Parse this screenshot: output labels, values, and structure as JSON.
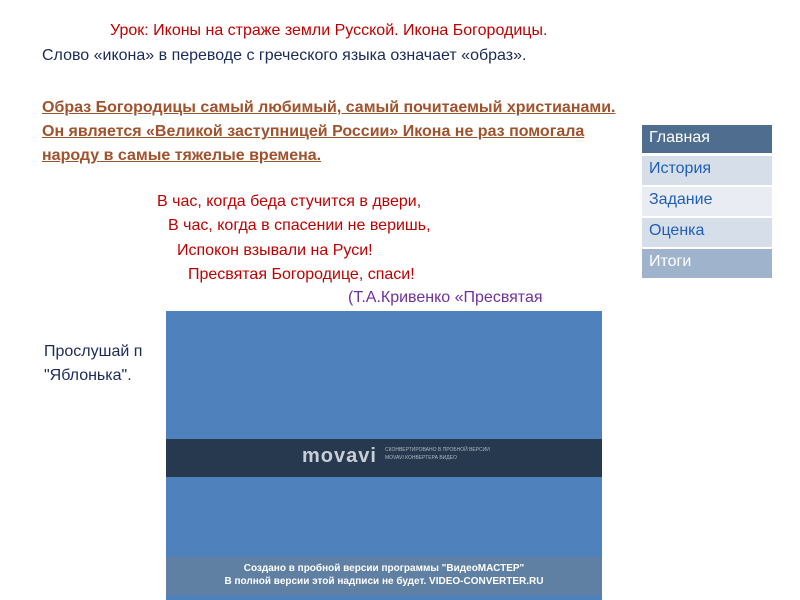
{
  "lesson": {
    "title": "Урок:  Иконы на страже земли Русской. Икона Богородицы.",
    "intro": "Слово  «икона» в переводе с греческого языка означает «образ».",
    "bold_text": "Образ Богородицы самый любимый, самый почитаемый христианами. Он является «Великой заступницей России» Икона не раз помогала народу в самые тяжелые времена.",
    "poem": [
      "В час, когда беда стучится в двери,",
      "В час, когда в спасении не веришь,",
      "Испокон взывали на Руси!",
      "Пресвятая   Богородице, спаси!"
    ],
    "attribution": "(Т.А.Кривенко  «Пресвятая",
    "listen_line1": " Прослушай п",
    "listen_line2": "\"Яблонька\"."
  },
  "video": {
    "logo": "movavi",
    "logo_sub_line1": "СКОНВЕРТИРОВАНО В ПРОБНОЙ ВЕРСИИ",
    "logo_sub_line2": "MOVAVI КОНВЕРТЕРА ВИДЕО",
    "trial_line1": "Создано в пробной версии программы \"ВидеоМАСТЕР\"",
    "trial_line2": "В полной версии этой надписи не будет. VIDEO-CONVERTER.RU"
  },
  "nav": {
    "items": [
      "Главная",
      "История",
      "Задание",
      "Оценка",
      "Итоги"
    ]
  },
  "colors": {
    "title": "#c00000",
    "bold_text": "#a0522d",
    "attribution": "#7030a0",
    "video_bg": "#4f81bd",
    "nav_header": "#4f6d8f",
    "nav_link": "#1f5eb5"
  }
}
